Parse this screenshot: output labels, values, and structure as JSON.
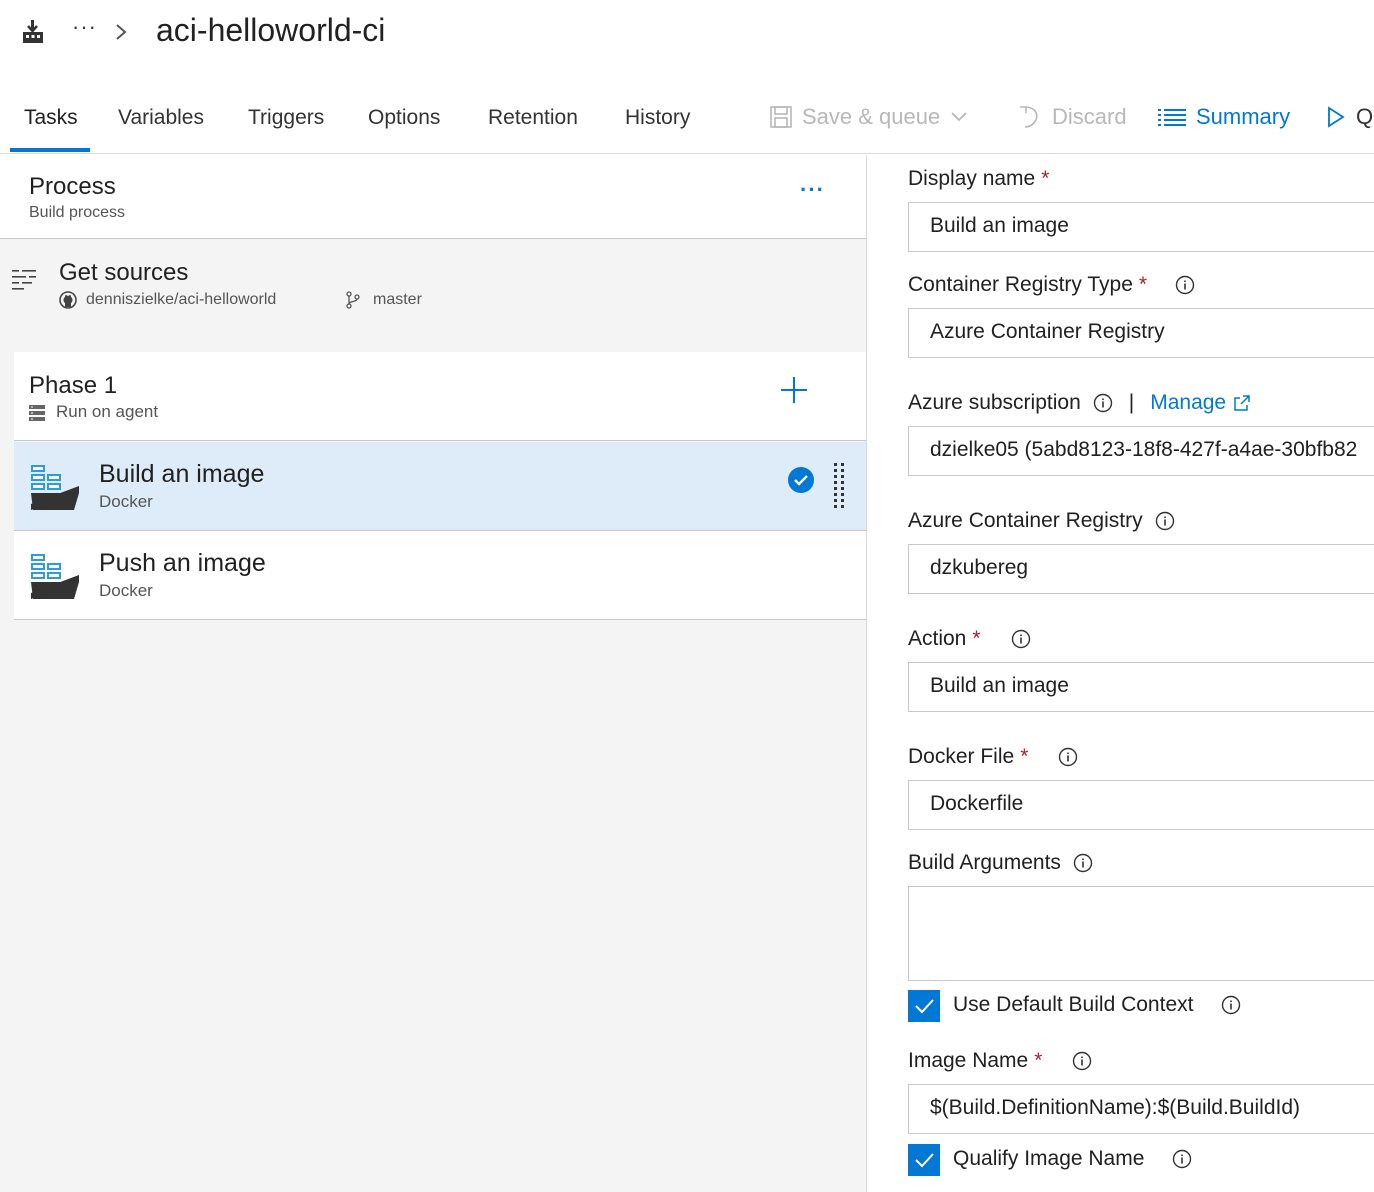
{
  "header": {
    "breadcrumb_more": "···",
    "definition_title": "aci-helloworld-ci"
  },
  "tabs": [
    {
      "label": "Tasks",
      "active": true
    },
    {
      "label": "Variables"
    },
    {
      "label": "Triggers"
    },
    {
      "label": "Options"
    },
    {
      "label": "Retention"
    },
    {
      "label": "History"
    }
  ],
  "toolbar": {
    "save_queue": "Save & queue",
    "discard": "Discard",
    "summary": "Summary",
    "queue_partial": "Q"
  },
  "process": {
    "title": "Process",
    "subtitle": "Build process",
    "more": "···"
  },
  "get_sources": {
    "title": "Get sources",
    "repository": "denniszielke/aci-helloworld",
    "branch": "master"
  },
  "phase": {
    "title": "Phase 1",
    "subtitle": "Run on agent"
  },
  "tasks": [
    {
      "title": "Build an image",
      "subtitle": "Docker",
      "selected": true
    },
    {
      "title": "Push an image",
      "subtitle": "Docker",
      "selected": false
    }
  ],
  "form": {
    "display_name": {
      "label": "Display name",
      "value": "Build an image"
    },
    "registry_type": {
      "label": "Container Registry Type",
      "value": "Azure Container Registry"
    },
    "subscription": {
      "label": "Azure subscription",
      "separator": "|",
      "manage": "Manage",
      "value": "dzielke05 (5abd8123-18f8-427f-a4ae-30bfb82"
    },
    "registry": {
      "label": "Azure Container Registry",
      "value": "dzkubereg"
    },
    "action": {
      "label": "Action",
      "value": "Build an image"
    },
    "docker_file": {
      "label": "Docker File",
      "value": "Dockerfile"
    },
    "build_args": {
      "label": "Build Arguments",
      "value": ""
    },
    "default_context": {
      "label": "Use Default Build Context",
      "checked": true
    },
    "image_name": {
      "label": "Image Name",
      "value": "$(Build.DefinitionName):$(Build.BuildId)"
    },
    "qualify_image": {
      "label": "Qualify Image Name",
      "checked": true
    }
  },
  "colors": {
    "accent": "#0078d4",
    "selected_row": "#deecf9",
    "required": "#a4262c",
    "panel_bg": "#f4f4f4"
  },
  "icons": {
    "pipeline": "build-pipeline-icon",
    "docker": "docker-whale-icon",
    "github": "github-icon",
    "branch": "git-branch-icon",
    "agent": "agent-server-icon",
    "info": "info-icon"
  }
}
